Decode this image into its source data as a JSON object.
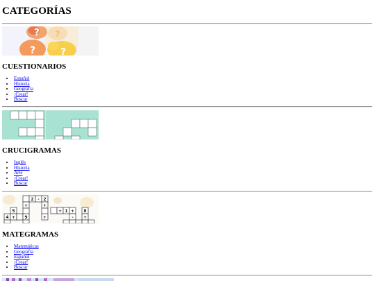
{
  "page": {
    "title": "CATEGORÍAS"
  },
  "sections": [
    {
      "title": "CUESTIONARIOS",
      "thumbnail_icon": "question-bubbles-illustration",
      "links": [
        "Español",
        "Historia",
        "Geografía",
        "¡Crear!",
        "Buscar"
      ]
    },
    {
      "title": "CRUCIGRAMAS",
      "thumbnail_icon": "crossword-grid-illustration",
      "links": [
        "Inglés",
        "Historia",
        "Arte",
        "¡Crear!",
        "Buscar"
      ]
    },
    {
      "title": "MATEGRAMAS",
      "thumbnail_icon": "math-crossword-illustration",
      "links": [
        "Matemáticas",
        "Geografía",
        "Español",
        "¡Crear!",
        "Buscar"
      ]
    },
    {
      "thumbnail_icon": "word-search-illustration"
    }
  ],
  "colors": {
    "link": "#0000ee",
    "crossword_teal": "#a8e2d2",
    "question_orange": "#f49a5c",
    "question_yellow": "#f8cf4a"
  }
}
